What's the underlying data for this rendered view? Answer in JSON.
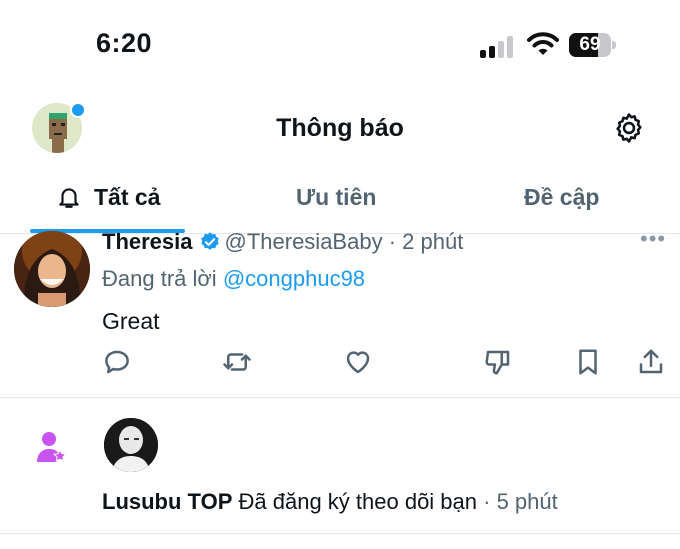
{
  "status_bar": {
    "time": "6:20",
    "battery": "69",
    "battery_level": 0.69
  },
  "header": {
    "title": "Thông báo"
  },
  "tabs": [
    {
      "label": "Tất cả",
      "active": true
    },
    {
      "label": "Ưu tiên",
      "active": false
    },
    {
      "label": "Đề cập",
      "active": false
    }
  ],
  "notification_reply": {
    "name": "Theresia",
    "handle": "@TheresiaBaby",
    "time": "· 2 phút",
    "replying_prefix": "Đang trả lời",
    "replying_to": "@congphuc98",
    "body": "Great"
  },
  "notification_follow": {
    "name": "Lusubu TOP",
    "action": "Đã đăng ký theo dõi bạn",
    "time": "· 5 phút"
  },
  "colors": {
    "accent": "#1d9bf0",
    "follow_icon": "#c855f0",
    "muted": "#536471"
  },
  "icons": [
    "bell-icon",
    "gear-icon",
    "verified-icon",
    "reply-icon",
    "retweet-icon",
    "like-icon",
    "dislike-icon",
    "bookmark-icon",
    "share-icon",
    "follow-person-icon"
  ]
}
